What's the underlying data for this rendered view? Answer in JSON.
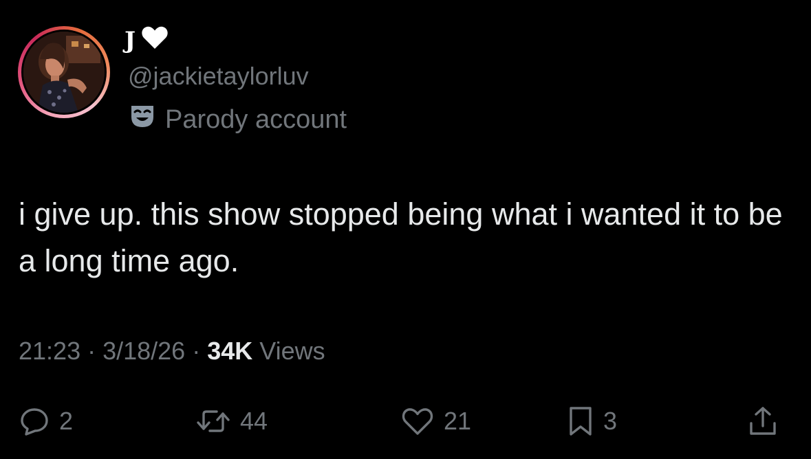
{
  "author": {
    "display_name": "J",
    "name_emoji_icon": "white-heart-icon",
    "handle": "@jackietaylorluv",
    "label_icon": "parody-mask-icon",
    "label": "Parody account"
  },
  "tweet": {
    "text": "i give up. this show stopped being what i wanted it to be a long time ago.",
    "time": "21:23",
    "separator": "·",
    "date": "3/18/26",
    "views_count": "34K",
    "views_label": "Views"
  },
  "actions": {
    "replies": "2",
    "reposts": "44",
    "likes": "21",
    "bookmarks": "3"
  },
  "colors": {
    "background": "#000000",
    "text": "#e7e9ea",
    "secondary": "#71767b"
  }
}
